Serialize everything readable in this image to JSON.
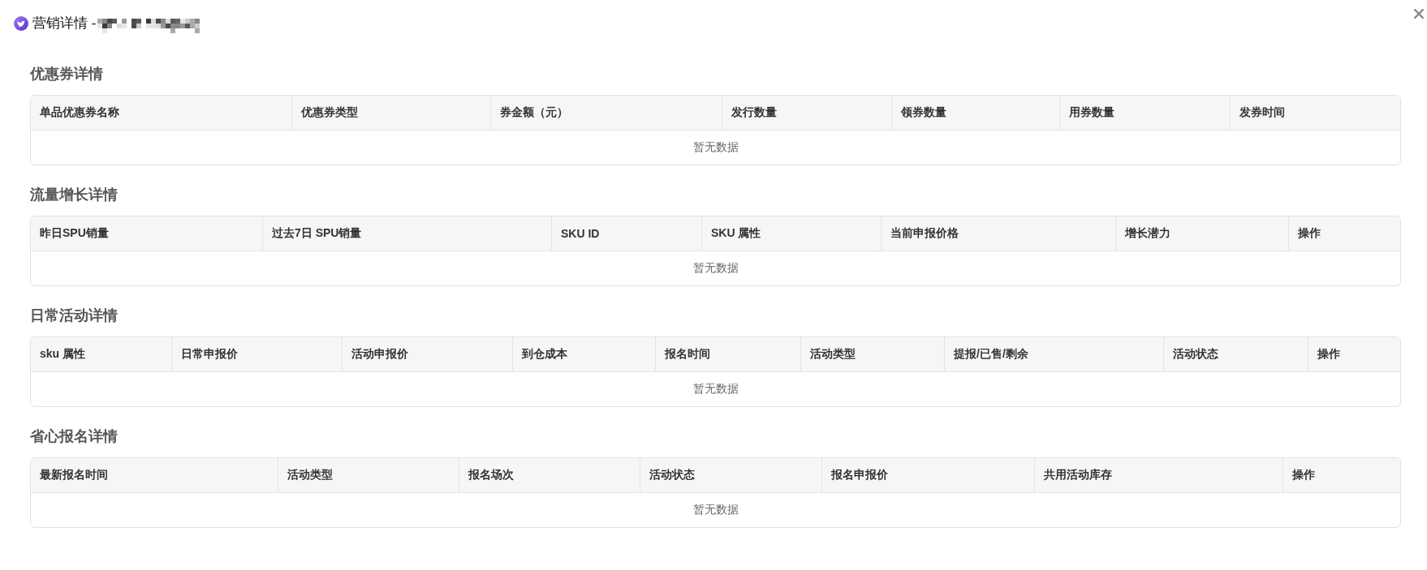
{
  "window": {
    "title": "营销详情 -"
  },
  "sections": [
    {
      "title": "优惠券详情",
      "table": {
        "columns": [
          "单品优惠券名称",
          "优惠券类型",
          "券金额（元）",
          "发行数量",
          "领券数量",
          "用券数量",
          "发券时间"
        ],
        "empty_text": "暂无数据"
      }
    },
    {
      "title": "流量增长详情",
      "table": {
        "columns": [
          "昨日SPU销量",
          "过去7日 SPU销量",
          "SKU ID",
          "SKU 属性",
          "当前申报价格",
          "增长潜力",
          "操作"
        ],
        "empty_text": "暂无数据"
      }
    },
    {
      "title": "日常活动详情",
      "table": {
        "columns": [
          "sku 属性",
          "日常申报价",
          "活动申报价",
          "到仓成本",
          "报名时间",
          "活动类型",
          "提报/已售/剩余",
          "活动状态",
          "操作"
        ],
        "empty_text": "暂无数据"
      }
    },
    {
      "title": "省心报名详情",
      "table": {
        "columns": [
          "最新报名时间",
          "活动类型",
          "报名场次",
          "活动状态",
          "报名申报价",
          "共用活动库存",
          "操作"
        ],
        "empty_text": "暂无数据"
      }
    }
  ]
}
